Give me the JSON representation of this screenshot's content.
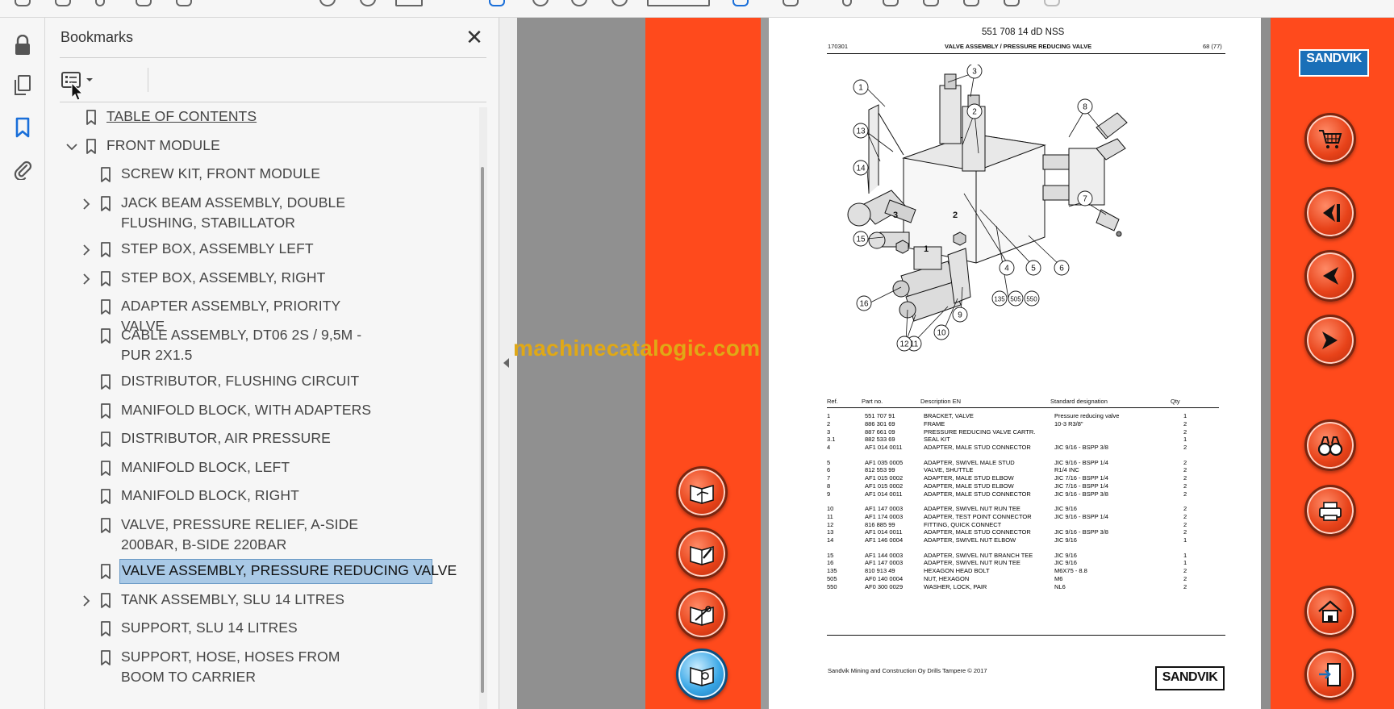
{
  "bookmarks_panel": {
    "title": "Bookmarks",
    "close_glyph": "✕",
    "items": [
      {
        "label": "TABLE OF CONTENTS",
        "level": 0,
        "expandable": false,
        "expanded": false,
        "selected": false,
        "link": true
      },
      {
        "label": "FRONT MODULE",
        "level": 0,
        "expandable": true,
        "expanded": true,
        "selected": false,
        "link": false
      },
      {
        "label": "SCREW KIT, FRONT MODULE",
        "level": 1,
        "expandable": false,
        "expanded": false,
        "selected": false,
        "link": false
      },
      {
        "label": "JACK BEAM ASSEMBLY, DOUBLE FLUSHING, STABILLATOR",
        "level": 1,
        "expandable": true,
        "expanded": false,
        "selected": false,
        "link": false
      },
      {
        "label": "STEP BOX, ASSEMBLY LEFT",
        "level": 1,
        "expandable": true,
        "expanded": false,
        "selected": false,
        "link": false
      },
      {
        "label": "STEP BOX, ASSEMBLY, RIGHT",
        "level": 1,
        "expandable": true,
        "expanded": false,
        "selected": false,
        "link": false
      },
      {
        "label": "ADAPTER ASSEMBLY, PRIORITY VALVE",
        "level": 1,
        "expandable": false,
        "expanded": false,
        "selected": false,
        "link": false
      },
      {
        "label": "CABLE ASSEMBLY, DT06 2S / 9,5M - PUR 2X1.5",
        "level": 1,
        "expandable": false,
        "expanded": false,
        "selected": false,
        "link": false
      },
      {
        "label": "DISTRIBUTOR, FLUSHING CIRCUIT",
        "level": 1,
        "expandable": false,
        "expanded": false,
        "selected": false,
        "link": false
      },
      {
        "label": "MANIFOLD BLOCK, WITH ADAPTERS",
        "level": 1,
        "expandable": false,
        "expanded": false,
        "selected": false,
        "link": false
      },
      {
        "label": "DISTRIBUTOR, AIR PRESSURE",
        "level": 1,
        "expandable": false,
        "expanded": false,
        "selected": false,
        "link": false
      },
      {
        "label": "MANIFOLD BLOCK, LEFT",
        "level": 1,
        "expandable": false,
        "expanded": false,
        "selected": false,
        "link": false
      },
      {
        "label": "MANIFOLD BLOCK, RIGHT",
        "level": 1,
        "expandable": false,
        "expanded": false,
        "selected": false,
        "link": false
      },
      {
        "label": "VALVE, PRESSURE RELIEF, A-SIDE 200BAR, B-SIDE 220BAR",
        "level": 1,
        "expandable": false,
        "expanded": false,
        "selected": false,
        "link": false
      },
      {
        "label": "VALVE ASSEMBLY, PRESSURE REDUCING VALVE",
        "level": 1,
        "expandable": false,
        "expanded": false,
        "selected": true,
        "link": false
      },
      {
        "label": "TANK ASSEMBLY, SLU 14 LITRES",
        "level": 1,
        "expandable": true,
        "expanded": false,
        "selected": false,
        "link": false
      },
      {
        "label": "SUPPORT, SLU 14 LITRES",
        "level": 1,
        "expandable": false,
        "expanded": false,
        "selected": false,
        "link": false
      },
      {
        "label": "SUPPORT, HOSE, HOSES FROM BOOM TO CARRIER",
        "level": 1,
        "expandable": false,
        "expanded": false,
        "selected": false,
        "link": false
      }
    ]
  },
  "rail": {
    "icons": [
      "lock-icon",
      "pages-icon",
      "bookmark-icon",
      "attachment-icon"
    ],
    "active": "bookmark-icon"
  },
  "document": {
    "code": "551 708 14 dD NSS",
    "date": "170301",
    "title": "VALVE ASSEMBLY / PRESSURE REDUCING VALVE",
    "page": "68 (77)",
    "diagram_callouts": [
      "1",
      "2",
      "3",
      "4",
      "5",
      "6",
      "7",
      "8",
      "9",
      "10",
      "11",
      "12",
      "13",
      "14",
      "15",
      "16",
      "135",
      "505",
      "550"
    ],
    "block_labels": [
      "3",
      "2",
      "1"
    ],
    "table": {
      "headers": {
        "ref": "Ref.",
        "part": "Part no.",
        "desc": "Description EN",
        "std": "Standard designation",
        "qty": "Qty"
      },
      "rows": [
        {
          "ref": "1",
          "part": "551 707 91",
          "desc": "BRACKET, VALVE",
          "std": "Pressure reducing valve",
          "qty": "1"
        },
        {
          "ref": "2",
          "part": "886 301 69",
          "desc": "FRAME",
          "std": "10-3 R3/8\"",
          "qty": "2"
        },
        {
          "ref": "3",
          "part": "887 661 09",
          "desc": "PRESSURE REDUCING VALVE CARTR.",
          "std": "",
          "qty": "2"
        },
        {
          "ref": "3.1",
          "part": "882 533 69",
          "desc": "SEAL KIT",
          "std": "",
          "qty": "1"
        },
        {
          "ref": "4",
          "part": "AF1 014 0011",
          "desc": "ADAPTER, MALE STUD CONNECTOR",
          "std": "JIC 9/16 - BSPP 3/8",
          "qty": "2"
        },
        {
          "ref": "5",
          "part": "AF1 035 0005",
          "desc": "ADAPTER, SWIVEL MALE STUD",
          "std": "JIC 9/16 - BSPP 1/4",
          "qty": "2"
        },
        {
          "ref": "6",
          "part": "812 553 99",
          "desc": "VALVE, SHUTTLE",
          "std": "R1/4 INC",
          "qty": "2"
        },
        {
          "ref": "7",
          "part": "AF1 015 0002",
          "desc": "ADAPTER, MALE STUD ELBOW",
          "std": "JIC 7/16 - BSPP 1/4",
          "qty": "2"
        },
        {
          "ref": "8",
          "part": "AF1 015 0002",
          "desc": "ADAPTER, MALE STUD ELBOW",
          "std": "JIC 7/16 - BSPP 1/4",
          "qty": "2"
        },
        {
          "ref": "9",
          "part": "AF1 014 0011",
          "desc": "ADAPTER, MALE STUD CONNECTOR",
          "std": "JIC 9/16 - BSPP 3/8",
          "qty": "2"
        },
        {
          "ref": "10",
          "part": "AF1 147 0003",
          "desc": "ADAPTER, SWIVEL NUT RUN TEE",
          "std": "JIC 9/16",
          "qty": "2"
        },
        {
          "ref": "11",
          "part": "AF1 174 0003",
          "desc": "ADAPTER, TEST POINT CONNECTOR",
          "std": "JIC 9/16 - BSPP 1/4",
          "qty": "2"
        },
        {
          "ref": "12",
          "part": "816 885 99",
          "desc": "FITTING, QUICK CONNECT",
          "std": "",
          "qty": "2"
        },
        {
          "ref": "13",
          "part": "AF1 014 0011",
          "desc": "ADAPTER, MALE STUD CONNECTOR",
          "std": "JIC 9/16 - BSPP 3/8",
          "qty": "2"
        },
        {
          "ref": "14",
          "part": "AF1 146 0004",
          "desc": "ADAPTER, SWIVEL NUT ELBOW",
          "std": "JIC 9/16",
          "qty": "1"
        },
        {
          "ref": "15",
          "part": "AF1 144 0003",
          "desc": "ADAPTER, SWIVEL NUT BRANCH TEE",
          "std": "JIC 9/16",
          "qty": "1"
        },
        {
          "ref": "16",
          "part": "AF1 147 0003",
          "desc": "ADAPTER, SWIVEL NUT RUN TEE",
          "std": "JIC 9/16",
          "qty": "1"
        },
        {
          "ref": "135",
          "part": "810 913 49",
          "desc": "HEXAGON HEAD BOLT",
          "std": "M6X75 - 8.8",
          "qty": "2"
        },
        {
          "ref": "505",
          "part": "AF0 140 0004",
          "desc": "NUT, HEXAGON",
          "std": "M6",
          "qty": "2"
        },
        {
          "ref": "550",
          "part": "AF0 300 0029",
          "desc": "WASHER, LOCK, PAIR",
          "std": "NL6",
          "qty": "2"
        }
      ]
    },
    "footer": "Sandvik Mining and Construction Oy Drills Tampere © 2017",
    "footer_logo": "SANDVIK"
  },
  "brand_logo": "SANDVIK",
  "watermark": "machinecatalogic.com",
  "left_nav_buttons": [
    "hand-book-icon",
    "edit-book-icon",
    "tool-book-icon",
    "book-search-icon"
  ],
  "right_nav_buttons": [
    "cart-icon",
    "first-page-icon",
    "previous-page-icon",
    "next-page-icon",
    "search-binoculars-icon",
    "print-icon",
    "home-icon",
    "exit-icon"
  ],
  "colors": {
    "accent_red": "#ff4a1c",
    "selection_bg": "#a9c9e6",
    "active_icon": "#1a6fd9",
    "logo_blue": "#1a6fb8"
  }
}
